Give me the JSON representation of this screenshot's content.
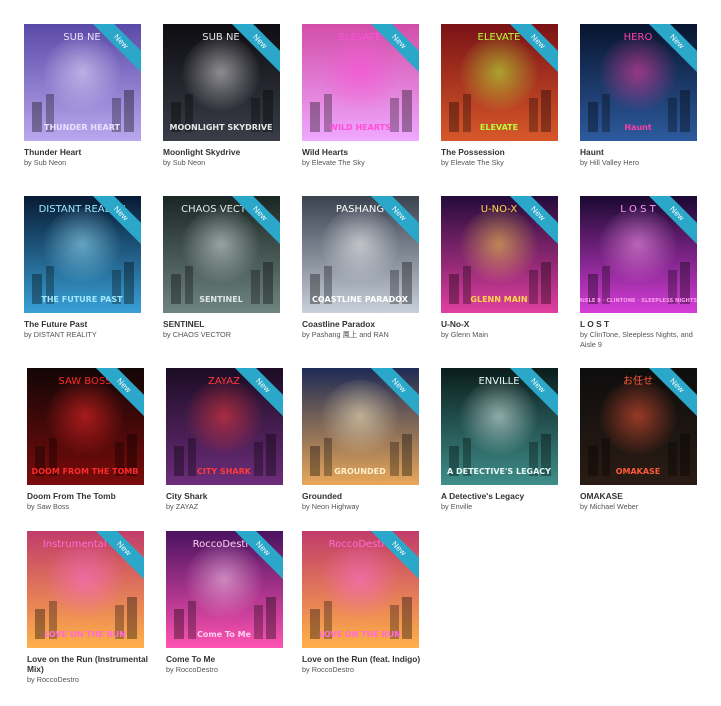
{
  "badge": "New",
  "albums": [
    {
      "title": "Thunder Heart",
      "artist": "by Sub Neon",
      "cover_text": [
        "SUB NE",
        "THUNDER HEART"
      ],
      "colors": [
        "#5a4aa8",
        "#b9a8ee"
      ],
      "accent": "#e9e2ff"
    },
    {
      "title": "Moonlight Skydrive",
      "artist": "by Sub Neon",
      "cover_text": [
        "SUB NE",
        "MOONLIGHT SKYDRIVE"
      ],
      "colors": [
        "#0d0d12",
        "#3a3d48"
      ],
      "accent": "#e6e6e6"
    },
    {
      "title": "Wild Hearts",
      "artist": "by Elevate The Sky",
      "cover_text": [
        "ELEVATE",
        "WILD HEARTS"
      ],
      "colors": [
        "#d24ea8",
        "#f0a8ff"
      ],
      "accent": "#ff4fd8"
    },
    {
      "title": "The Possession",
      "artist": "by Elevate The Sky",
      "cover_text": [
        "ELEVATE",
        "ELEVATE"
      ],
      "colors": [
        "#7a1216",
        "#d8582a"
      ],
      "accent": "#b6ff3a"
    },
    {
      "title": "Haunt",
      "artist": "by Hill Valley Hero",
      "cover_text": [
        "HERO",
        "Haunt"
      ],
      "colors": [
        "#08142e",
        "#2d5a9e"
      ],
      "accent": "#ff3ea5"
    },
    {
      "title": "The Future Past",
      "artist": "by DISTANT REALITY",
      "cover_text": [
        "DISTANT REALITY",
        "THE FUTURE PAST"
      ],
      "colors": [
        "#071a33",
        "#3aa1d8"
      ],
      "accent": "#9fe8ff"
    },
    {
      "title": "SENTINEL",
      "artist": "by CHAOS VECTOR",
      "cover_text": [
        "CHAOS VECTOR",
        "SENTINEL"
      ],
      "colors": [
        "#1a2624",
        "#6f8580"
      ],
      "accent": "#dfe8e6"
    },
    {
      "title": "Coastline Paradox",
      "artist": "by Pashang 鳳上 and RAN",
      "cover_text": [
        "PASHANG",
        "COASTLINE PARADOX"
      ],
      "colors": [
        "#3b4250",
        "#c8d0da"
      ],
      "accent": "#ffffff"
    },
    {
      "title": "U-No-X",
      "artist": "by Glenn Main",
      "cover_text": [
        "U-NO-X",
        "GLENN MAIN"
      ],
      "colors": [
        "#240b3b",
        "#e23fa0"
      ],
      "accent": "#ffd84a"
    },
    {
      "title": "L O S T",
      "artist": "by ClinTone, Sleepless Nights, and Aisle 9",
      "cover_text": [
        "L O S T",
        "AISLE 9 · CLINTONE · SLEEPLESS NIGHTS"
      ],
      "colors": [
        "#1a0930",
        "#d63dd8"
      ],
      "accent": "#ff9df0"
    },
    {
      "title": "Doom From The Tomb",
      "artist": "by Saw Boss",
      "cover_text": [
        "SAW BOSS",
        "DOOM FROM THE TOMB"
      ],
      "colors": [
        "#120606",
        "#7a0b0b"
      ],
      "accent": "#ff2a2a"
    },
    {
      "title": "City Shark",
      "artist": "by ZAYAZ",
      "cover_text": [
        "ZAYAZ",
        "CITY SHARK"
      ],
      "colors": [
        "#1b0c24",
        "#6d2d7a"
      ],
      "accent": "#ff3b3b"
    },
    {
      "title": "Grounded",
      "artist": "by Neon Highway",
      "cover_text": [
        "",
        "GROUNDED"
      ],
      "colors": [
        "#1e2b55",
        "#e9a85a"
      ],
      "accent": "#fff2c9"
    },
    {
      "title": "A Detective's Legacy",
      "artist": "by Enville",
      "cover_text": [
        "ENVILLE",
        "A DETECTIVE'S LEGACY"
      ],
      "colors": [
        "#0a1d1c",
        "#3f8e8a"
      ],
      "accent": "#e8f8f6"
    },
    {
      "title": "OMAKASE",
      "artist": "by Michael Weber",
      "cover_text": [
        "お任せ",
        "OMAKASE"
      ],
      "colors": [
        "#0d0d0d",
        "#2a1c14"
      ],
      "accent": "#ff5a3a"
    },
    {
      "title": "Love on the Run (Instrumental Mix)",
      "artist": "by RoccoDestro",
      "cover_text": [
        "Instrumental Mix",
        "LOVE ON THE RUN"
      ],
      "colors": [
        "#c13c6a",
        "#ffb04a"
      ],
      "accent": "#ff6dd9"
    },
    {
      "title": "Come To Me",
      "artist": "by RoccoDestro",
      "cover_text": [
        "RoccoDestro",
        "Come To Me"
      ],
      "colors": [
        "#4a1260",
        "#ff53b2"
      ],
      "accent": "#ffd0f0"
    },
    {
      "title": "Love on the Run (feat. Indigo)",
      "artist": "by RoccoDestro",
      "cover_text": [
        "RoccoDestro",
        "LOVE ON THE RUN"
      ],
      "colors": [
        "#c13c6a",
        "#ffb04a"
      ],
      "accent": "#ff6dd9"
    }
  ]
}
